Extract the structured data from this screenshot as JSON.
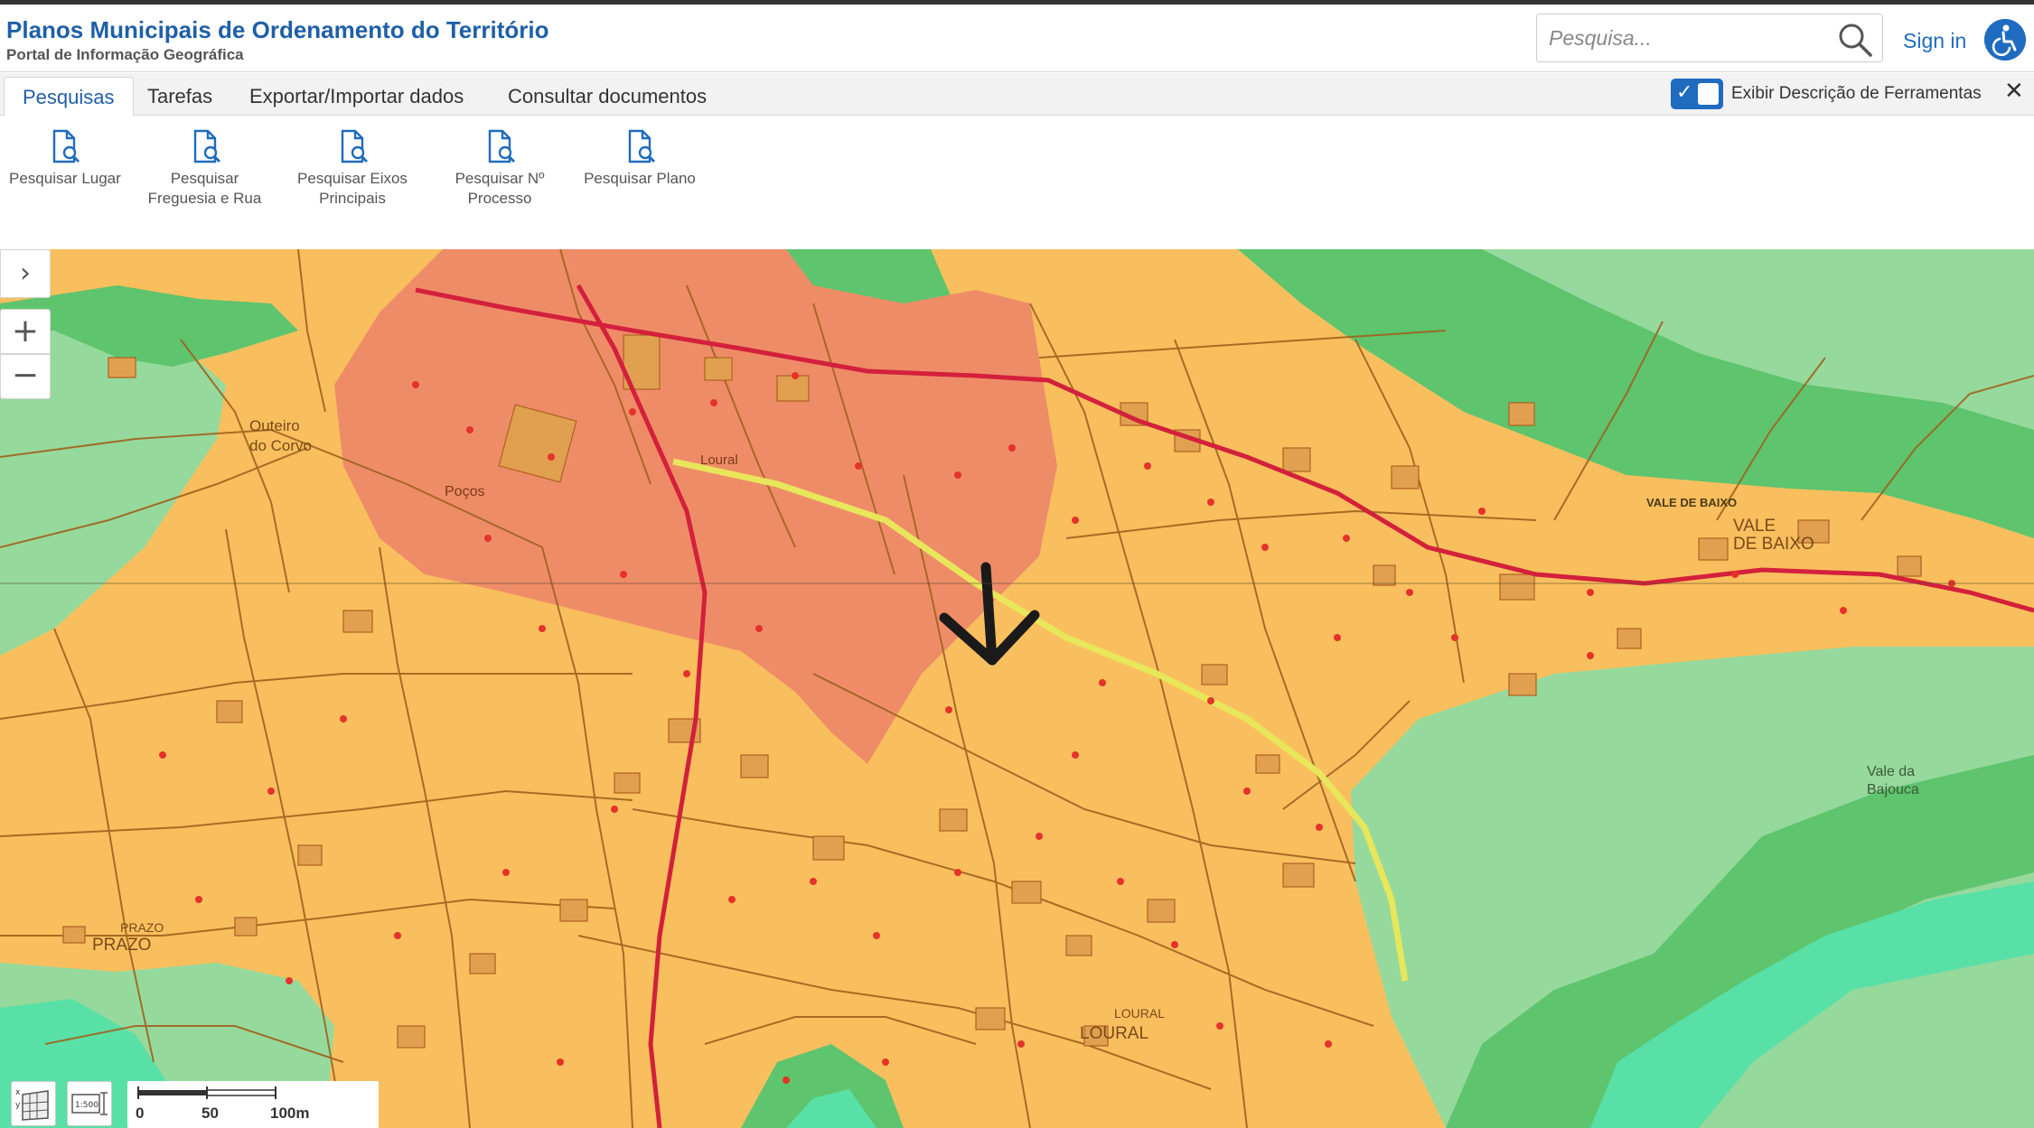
{
  "header": {
    "title": "Planos Municipais de Ordenamento do Território",
    "subtitle": "Portal de Informação Geográfica",
    "search_placeholder": "Pesquisa...",
    "sign_in": "Sign in"
  },
  "tabs": [
    {
      "label": "Pesquisas",
      "active": true
    },
    {
      "label": "Tarefas",
      "active": false
    },
    {
      "label": "Exportar/Importar dados",
      "active": false
    },
    {
      "label": "Consultar documentos",
      "active": false
    }
  ],
  "tooltip_toggle": {
    "label": "Exibir Descrição de Ferramentas",
    "checked": true
  },
  "toolbar": {
    "tools": [
      {
        "line1": "Pesquisar Lugar",
        "line2": "",
        "icon": "search-document-icon"
      },
      {
        "line1": "Pesquisar",
        "line2": "Freguesia e Rua",
        "icon": "search-document-icon"
      },
      {
        "line1": "Pesquisar Eixos",
        "line2": "Principais",
        "icon": "search-document-icon"
      },
      {
        "line1": "Pesquisar Nº",
        "line2": "Processo",
        "icon": "search-document-icon"
      },
      {
        "line1": "Pesquisar Plano",
        "line2": "",
        "icon": "search-document-icon"
      }
    ]
  },
  "map": {
    "place_labels": {
      "outeiro_line1": "Outeiro",
      "outeiro_line2": "do Corvo",
      "pocos": "Poços",
      "loural_small": "Loural",
      "vale_de_baixo_small": "VALE DE BAIXO",
      "vale_line1": "VALE",
      "vale_line2": "DE BAIXO",
      "vale_da_line1": "Vale da",
      "vale_da_line2": "Bajouca",
      "prazo_small": "PRAZO",
      "prazo": "PRAZO",
      "loural_large": "LOURAL",
      "loural_small2": "LOURAL"
    },
    "scalebar": {
      "labels": [
        "0",
        "50",
        "100m"
      ]
    },
    "scale_button": "1:500",
    "colors": {
      "urban_consolidated": "#ef8c68",
      "urban_expansion": "#f9bf5e",
      "agricultural": "#96d99c",
      "forest": "#5ec46d",
      "riparian": "#58e0a6",
      "parcel_lines": "#a0621e",
      "main_road": "#d3203c",
      "highlight_road": "#e8e65a",
      "accent": "#1f6bc0"
    }
  }
}
